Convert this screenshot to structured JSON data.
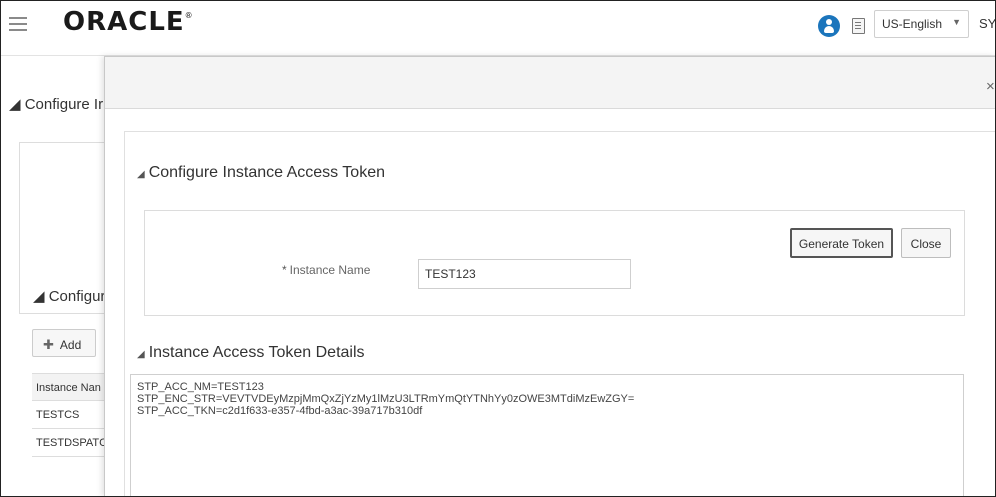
{
  "header": {
    "logo_text": "ORACLE",
    "logo_mark": "®",
    "language": "US-English",
    "user": "SYSA"
  },
  "background": {
    "section1_title": "◢ Configure Ir",
    "section2_title": "◢ Configur",
    "add_label": "Add",
    "table_header": "Instance Nan",
    "rows": [
      "TESTCS",
      "TESTDSPATC"
    ]
  },
  "modal": {
    "close_symbol": "×",
    "token_section_title": "Configure Instance Access Token",
    "generate_label": "Generate Token",
    "close_label": "Close",
    "instance_name_label": "Instance Name",
    "instance_name_value": "TEST123",
    "details_section_title": "Instance Access Token Details",
    "details_lines": [
      "STP_ACC_NM=TEST123",
      "STP_ENC_STR=VEVTVDEyMzpjMmQxZjYzMy1lMzU3LTRmYmQtYTNhYy0zOWE3MTdiMzEwZGY=",
      "STP_ACC_TKN=c2d1f633-e357-4fbd-a3ac-39a717b310df"
    ]
  },
  "icons": {
    "menu": "hamburger-icon",
    "user": "user-avatar-icon",
    "doc": "document-icon",
    "dropdown": "chevron-down-icon",
    "close": "close-icon",
    "collapse": "triangle-collapse-icon",
    "add": "plus-icon"
  },
  "colors": {
    "accent": "#1b75bc"
  }
}
